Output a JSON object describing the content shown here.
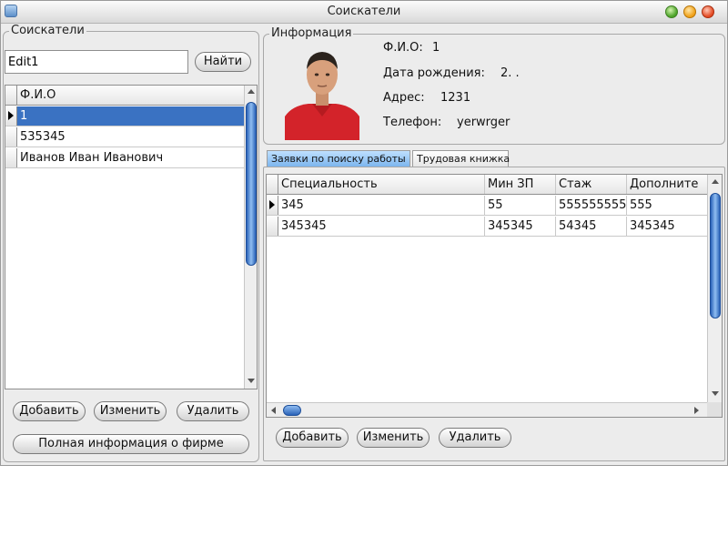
{
  "window": {
    "title": "Соискатели"
  },
  "left_panel": {
    "group_title": "Соискатели",
    "search_value": "Edit1",
    "search_button": "Найти",
    "list_header": "Ф.И.О",
    "list_items": [
      "1",
      "535345",
      "Иванов Иван Иванович"
    ],
    "selected_index": 0,
    "buttons": {
      "add": "Добавить",
      "edit": "Изменить",
      "delete": "Удалить",
      "full_info": "Полная информация о фирме"
    }
  },
  "info_panel": {
    "group_title": "Информация",
    "fio_label": "Ф.И.О:",
    "fio_value": "1",
    "birth_label": "Дата рождения:",
    "birth_value": "2. .",
    "address_label": "Адрес:",
    "address_value": "1231",
    "phone_label": "Телефон:",
    "phone_value": "yerwrger"
  },
  "tabs": [
    "Заявки по поиску работы",
    "Трудовая книжка"
  ],
  "active_tab": 0,
  "applications_table": {
    "columns": [
      "Специальность",
      "Мин ЗП",
      "Стаж",
      "Дополните"
    ],
    "rows": [
      [
        "345",
        "55",
        "555555555",
        "555"
      ],
      [
        "345345",
        "345345",
        "54345",
        "345345"
      ]
    ],
    "current_row": 0
  },
  "bottom_buttons": {
    "add": "Добавить",
    "edit": "Изменить",
    "delete": "Удалить"
  },
  "colors": {
    "selection": "#3a72c2",
    "scroll_thumb": "#2a62b8",
    "active_tab": "#7cb5ee"
  }
}
